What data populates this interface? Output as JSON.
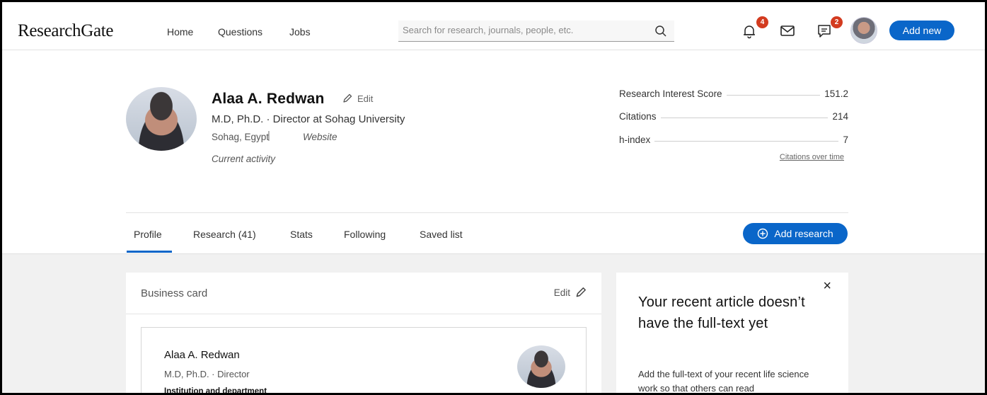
{
  "header": {
    "logo": "ResearchGate",
    "nav": [
      "Home",
      "Questions",
      "Jobs"
    ],
    "search_placeholder": "Search for research, journals, people, etc.",
    "notifications_count": "4",
    "messages_count": "2",
    "add_new_label": "Add new"
  },
  "profile": {
    "name": "Alaa A. Redwan",
    "edit_label": "Edit",
    "title": "M.D, Ph.D. · Director at Sohag University",
    "location": "Sohag, Egypt",
    "separator": "|",
    "website_label": "Website",
    "current_activity": "Current activity"
  },
  "stats": {
    "items": [
      {
        "label": "Research Interest Score",
        "value": "151.2"
      },
      {
        "label": "Citations",
        "value": "214"
      },
      {
        "label": "h-index",
        "value": "7"
      }
    ],
    "citations_link": "Citations over time"
  },
  "tabs": {
    "items": [
      "Profile",
      "Research (41)",
      "Stats",
      "Following",
      "Saved list"
    ],
    "active": "Profile",
    "add_research_label": "Add research"
  },
  "business_card": {
    "title": "Business card",
    "edit_label": "Edit",
    "name": "Alaa A. Redwan",
    "position": "M.D, Ph.D. · Director",
    "institution_label": "Institution and department"
  },
  "promo": {
    "title": "Your recent article doesn’t have the full-text yet",
    "body": "Add the full-text of your recent life science work so that others can read",
    "close_label": "×"
  },
  "colors": {
    "accent": "#0a66c9",
    "badge": "#d33b1f",
    "content_bg": "#f1f1f1"
  }
}
